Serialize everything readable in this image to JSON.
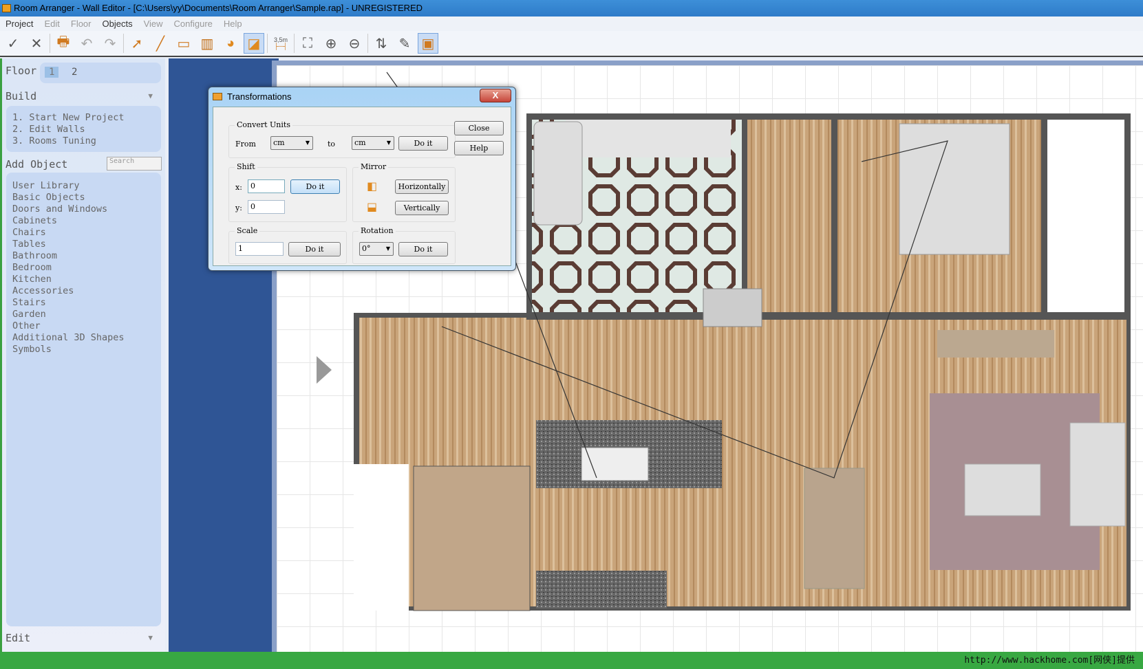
{
  "window": {
    "title": "Room Arranger - Wall Editor - [C:\\Users\\yy\\Documents\\Room Arranger\\Sample.rap] - UNREGISTERED"
  },
  "menu": [
    {
      "label": "Project",
      "enabled": true
    },
    {
      "label": "Edit",
      "enabled": false
    },
    {
      "label": "Floor",
      "enabled": false
    },
    {
      "label": "Objects",
      "enabled": true
    },
    {
      "label": "View",
      "enabled": false
    },
    {
      "label": "Configure",
      "enabled": false
    },
    {
      "label": "Help",
      "enabled": false
    }
  ],
  "toolbar": {
    "scale_label": "3,5m"
  },
  "sidebar": {
    "floor_label": "Floor",
    "floors": [
      "1",
      "2"
    ],
    "selected_floor": "1",
    "build_label": "Build",
    "build_steps": [
      "1. Start New Project",
      "2. Edit Walls",
      "3. Rooms Tuning"
    ],
    "add_object_label": "Add Object",
    "search_placeholder": "Search",
    "categories": [
      "User Library",
      "Basic Objects",
      "Doors and Windows",
      "Cabinets",
      "Chairs",
      "Tables",
      "Bathroom",
      "Bedroom",
      "Kitchen",
      "Accessories",
      "Stairs",
      "Garden",
      "Other",
      "Additional 3D Shapes",
      "Symbols"
    ],
    "edit_label": "Edit"
  },
  "dialog": {
    "title": "Transformations",
    "close_label": "Close",
    "help_label": "Help",
    "convert_units": {
      "label": "Convert Units",
      "from_label": "From",
      "from_value": "cm",
      "to_label": "to",
      "to_value": "cm",
      "do_it": "Do it"
    },
    "shift": {
      "label": "Shift",
      "x_label": "x:",
      "x_value": "0",
      "y_label": "y:",
      "y_value": "0",
      "do_it": "Do it"
    },
    "mirror": {
      "label": "Mirror",
      "horizontal": "Horizontally",
      "vertical": "Vertically"
    },
    "scale": {
      "label": "Scale",
      "value": "1",
      "do_it": "Do it"
    },
    "rotation": {
      "label": "Rotation",
      "value": "0°",
      "do_it": "Do it"
    }
  },
  "status": {
    "watermark": "http://www.hackhome.com[网侠]提供"
  }
}
